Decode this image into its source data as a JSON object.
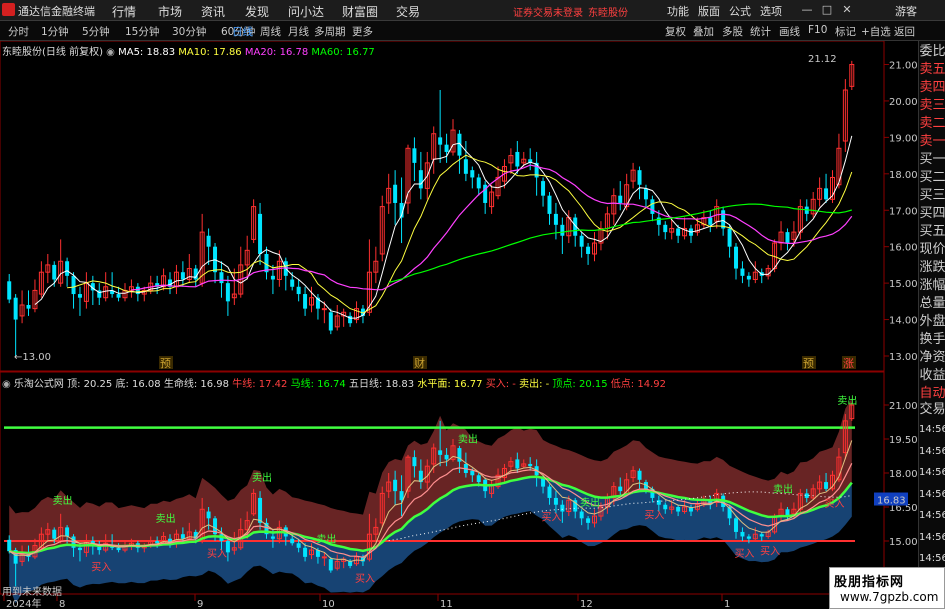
{
  "app": {
    "name": "通达信金融终端",
    "notice": "证券交易未登录",
    "stock_link": "东睦股份",
    "guest": "游客"
  },
  "menu": [
    "行情",
    "市场",
    "资讯",
    "发现",
    "问小达",
    "财富圈",
    "交易"
  ],
  "right_menu": [
    "功能",
    "版面",
    "公式",
    "选项"
  ],
  "period_tabs": [
    "分时",
    "1分钟",
    "5分钟",
    "15分钟",
    "30分钟",
    "60分钟",
    "日线",
    "周线",
    "月线",
    "多周期",
    "更多"
  ],
  "active_tab": "日线",
  "right_tabs": [
    "复权",
    "叠加",
    "多股",
    "统计",
    "画线",
    "F10",
    "标记",
    "+自选",
    "返回"
  ],
  "main_legend": {
    "title": "东睦股份(日线 前复权)",
    "ma5": "MA5: 18.83",
    "ma10": "MA10: 17.86",
    "ma20": "MA20: 16.78",
    "ma60": "MA60: 16.77"
  },
  "indicator_legend": {
    "name": "乐淘公式网",
    "top": "顶: 20.25",
    "bottom": "底: 16.08",
    "life": "生命线: 16.98",
    "ox": "牛线: 17.42",
    "horse": "马线: 16.74",
    "ma5": "五日线: 18.83",
    "level": "水平面: 16.77",
    "buy": "买入: -",
    "sell": "卖出: -",
    "peak": "顶点: 20.15",
    "trough": "低点: 14.92"
  },
  "main_y_ticks": [
    "21.00",
    "20.00",
    "19.00",
    "18.00",
    "17.00",
    "16.00",
    "15.00",
    "14.00",
    "13.00"
  ],
  "main_annotations": {
    "high": "21.12",
    "low": "13.00"
  },
  "event_markers": [
    "预",
    "财",
    "预",
    "涨"
  ],
  "ind_y_ticks": [
    "21.00",
    "19.50",
    "18.00",
    "16.50",
    "15.00"
  ],
  "ind_current": "16.83",
  "right_panel": [
    "委比",
    "卖五",
    "卖四",
    "卖三",
    "卖二",
    "卖一",
    "买一",
    "买二",
    "买三",
    "买四",
    "买五",
    "现价",
    "涨跌",
    "涨幅",
    "总量",
    "外盘",
    "换手",
    "净资",
    "收益",
    "自动",
    "交易",
    "14:56",
    "14:56",
    "14:56",
    "14:56",
    "14:56",
    "14:56",
    "14:56",
    "14:56"
  ],
  "x_labels": [
    "2024年",
    "8",
    "9",
    "10",
    "11",
    "12",
    "1"
  ],
  "signals": {
    "buy": "买入",
    "sell": "卖出"
  },
  "nodata_text": "用到未来数据",
  "watermark": {
    "line1": "股朋指标网",
    "line2": "www.7gpzb.com"
  },
  "colors": {
    "up": "#ff3030",
    "down": "#00e5ff",
    "ma5": "#ffffff",
    "ma10": "#ffff40",
    "ma20": "#ff40ff",
    "ma60": "#00ff00",
    "accent": "#4aa0ff"
  },
  "chart_data": {
    "type": "candlestick",
    "candles": [
      [
        15.05,
        14.55,
        15.25,
        14.45
      ],
      [
        14.6,
        14.0,
        14.7,
        13.0
      ],
      [
        14.1,
        14.4,
        14.8,
        13.9
      ],
      [
        14.4,
        14.3,
        14.8,
        14.1
      ],
      [
        14.3,
        14.8,
        15.1,
        14.2
      ],
      [
        14.7,
        15.3,
        15.6,
        14.6
      ],
      [
        15.3,
        15.5,
        15.8,
        15.0
      ],
      [
        15.5,
        15.1,
        15.6,
        14.9
      ],
      [
        15.0,
        15.6,
        16.2,
        14.9
      ],
      [
        15.6,
        15.2,
        15.7,
        14.9
      ],
      [
        15.2,
        14.7,
        15.3,
        14.3
      ],
      [
        14.7,
        14.6,
        14.9,
        14.1
      ],
      [
        14.5,
        15.0,
        15.3,
        14.3
      ],
      [
        15.0,
        14.8,
        15.2,
        14.4
      ],
      [
        14.8,
        14.6,
        15.0,
        14.4
      ],
      [
        14.6,
        14.9,
        15.3,
        14.5
      ],
      [
        14.8,
        14.7,
        15.3,
        14.6
      ],
      [
        14.7,
        14.6,
        14.9,
        14.5
      ],
      [
        14.6,
        14.8,
        15.0,
        14.5
      ],
      [
        14.8,
        14.9,
        15.1,
        14.6
      ],
      [
        14.9,
        14.7,
        15.0,
        14.5
      ],
      [
        14.7,
        14.8,
        14.9,
        14.5
      ],
      [
        14.8,
        15.0,
        15.2,
        14.7
      ],
      [
        15.0,
        14.9,
        15.2,
        14.7
      ],
      [
        14.9,
        15.2,
        15.4,
        14.8
      ],
      [
        15.1,
        14.9,
        15.3,
        14.7
      ],
      [
        14.9,
        15.3,
        15.5,
        14.7
      ],
      [
        15.3,
        15.1,
        15.6,
        14.9
      ],
      [
        15.1,
        15.4,
        15.8,
        15.0
      ],
      [
        15.4,
        15.1,
        15.5,
        14.9
      ],
      [
        15.0,
        16.4,
        16.9,
        14.9
      ],
      [
        16.3,
        16.0,
        16.5,
        15.5
      ],
      [
        16.0,
        15.3,
        16.1,
        15.0
      ],
      [
        15.3,
        15.0,
        15.6,
        14.6
      ],
      [
        15.0,
        14.5,
        15.2,
        14.1
      ],
      [
        14.6,
        14.7,
        15.4,
        14.4
      ],
      [
        14.7,
        15.5,
        16.0,
        14.6
      ],
      [
        15.5,
        15.9,
        16.3,
        15.1
      ],
      [
        16.2,
        17.1,
        17.3,
        16.1
      ],
      [
        16.9,
        15.8,
        17.2,
        15.5
      ],
      [
        15.8,
        15.3,
        16.0,
        15.1
      ],
      [
        15.2,
        15.1,
        15.5,
        14.7
      ],
      [
        15.1,
        15.6,
        15.9,
        14.9
      ],
      [
        15.6,
        15.2,
        15.7,
        14.8
      ],
      [
        15.1,
        14.9,
        15.3,
        14.8
      ],
      [
        14.9,
        14.7,
        15.1,
        14.5
      ],
      [
        14.7,
        14.3,
        14.9,
        14.1
      ],
      [
        14.4,
        14.6,
        14.9,
        14.2
      ],
      [
        14.6,
        14.3,
        14.7,
        14.0
      ],
      [
        14.3,
        14.3,
        14.5,
        13.9
      ],
      [
        14.2,
        13.7,
        14.3,
        13.6
      ],
      [
        13.8,
        14.1,
        14.4,
        13.7
      ],
      [
        14.1,
        14.2,
        14.3,
        13.8
      ],
      [
        14.1,
        13.9,
        14.2,
        13.8
      ],
      [
        14.0,
        14.3,
        14.5,
        13.9
      ],
      [
        14.3,
        14.1,
        14.4,
        13.9
      ],
      [
        14.2,
        15.3,
        16.2,
        14.1
      ],
      [
        15.3,
        15.6,
        16.0,
        15.0
      ],
      [
        15.8,
        17.1,
        17.4,
        15.6
      ],
      [
        17.2,
        17.6,
        18.0,
        16.9
      ],
      [
        17.7,
        17.2,
        18.1,
        16.6
      ],
      [
        17.2,
        16.8,
        17.9,
        16.1
      ],
      [
        17.2,
        18.7,
        18.8,
        16.9
      ],
      [
        18.7,
        18.3,
        19.0,
        17.8
      ],
      [
        18.1,
        17.6,
        18.6,
        17.3
      ],
      [
        17.6,
        18.3,
        18.6,
        17.3
      ],
      [
        18.4,
        19.1,
        19.3,
        18.0
      ],
      [
        19.0,
        18.8,
        20.3,
        18.3
      ],
      [
        18.8,
        18.6,
        19.1,
        18.3
      ],
      [
        18.6,
        19.2,
        19.5,
        18.5
      ],
      [
        19.1,
        18.5,
        19.2,
        18.0
      ],
      [
        18.4,
        18.0,
        18.9,
        17.8
      ],
      [
        18.1,
        17.9,
        18.2,
        17.6
      ],
      [
        17.9,
        17.6,
        18.0,
        17.4
      ],
      [
        17.7,
        17.2,
        17.8,
        16.9
      ],
      [
        17.1,
        17.5,
        17.7,
        16.9
      ],
      [
        17.4,
        17.9,
        18.2,
        17.3
      ],
      [
        17.8,
        18.2,
        18.4,
        17.6
      ],
      [
        18.3,
        18.5,
        18.7,
        18.0
      ],
      [
        18.6,
        18.2,
        18.9,
        18.0
      ],
      [
        18.3,
        18.4,
        18.6,
        18.2
      ],
      [
        18.4,
        18.3,
        18.7,
        18.1
      ],
      [
        18.3,
        17.9,
        18.6,
        17.4
      ],
      [
        17.8,
        17.4,
        17.9,
        17.1
      ],
      [
        17.4,
        16.9,
        17.5,
        16.6
      ],
      [
        16.9,
        16.6,
        17.2,
        16.2
      ],
      [
        16.6,
        16.3,
        16.8,
        15.8
      ],
      [
        16.3,
        16.8,
        17.0,
        16.1
      ],
      [
        16.8,
        16.3,
        16.9,
        16.0
      ],
      [
        16.3,
        16.0,
        16.4,
        15.7
      ],
      [
        16.0,
        15.8,
        16.1,
        15.5
      ],
      [
        15.8,
        16.1,
        16.4,
        15.6
      ],
      [
        16.1,
        16.5,
        16.7,
        15.9
      ],
      [
        16.5,
        16.9,
        17.1,
        16.2
      ],
      [
        16.9,
        17.4,
        17.6,
        16.6
      ],
      [
        17.4,
        17.2,
        17.8,
        17.0
      ],
      [
        17.1,
        17.7,
        18.0,
        17.0
      ],
      [
        17.8,
        18.1,
        18.3,
        17.6
      ],
      [
        18.1,
        17.7,
        18.2,
        17.3
      ],
      [
        17.6,
        17.3,
        17.7,
        17.1
      ],
      [
        17.3,
        16.9,
        17.4,
        16.7
      ],
      [
        16.8,
        16.6,
        17.0,
        16.3
      ],
      [
        16.6,
        16.4,
        16.7,
        16.2
      ],
      [
        16.4,
        16.5,
        16.8,
        16.2
      ],
      [
        16.5,
        16.3,
        16.6,
        16.1
      ],
      [
        16.3,
        16.5,
        16.8,
        16.2
      ],
      [
        16.5,
        16.3,
        16.6,
        16.1
      ],
      [
        16.4,
        16.6,
        16.8,
        16.3
      ],
      [
        16.6,
        16.8,
        17.0,
        16.5
      ],
      [
        16.8,
        16.6,
        17.0,
        16.4
      ],
      [
        16.7,
        17.1,
        17.3,
        16.5
      ],
      [
        17.0,
        16.5,
        17.1,
        16.3
      ],
      [
        16.5,
        16.0,
        16.6,
        15.7
      ],
      [
        16.0,
        15.4,
        16.1,
        15.1
      ],
      [
        15.4,
        15.2,
        15.6,
        15.0
      ],
      [
        15.2,
        15.1,
        15.3,
        14.9
      ],
      [
        15.1,
        15.3,
        15.6,
        15.0
      ],
      [
        15.3,
        15.2,
        15.4,
        15.0
      ],
      [
        15.2,
        15.4,
        15.5,
        15.1
      ],
      [
        15.4,
        16.1,
        16.2,
        15.3
      ],
      [
        16.1,
        16.4,
        16.7,
        15.9
      ],
      [
        16.4,
        16.1,
        16.5,
        15.9
      ],
      [
        16.2,
        16.4,
        16.7,
        16.0
      ],
      [
        16.4,
        17.1,
        17.3,
        16.2
      ],
      [
        17.1,
        16.9,
        17.3,
        16.7
      ],
      [
        16.9,
        17.3,
        17.5,
        16.8
      ],
      [
        17.3,
        17.6,
        17.9,
        17.1
      ],
      [
        17.6,
        17.3,
        18.0,
        17.2
      ],
      [
        17.3,
        17.9,
        18.1,
        17.2
      ],
      [
        17.7,
        18.7,
        19.1,
        17.6
      ],
      [
        18.9,
        20.3,
        20.6,
        18.6
      ],
      [
        20.4,
        21.0,
        21.1,
        20.3
      ]
    ]
  }
}
